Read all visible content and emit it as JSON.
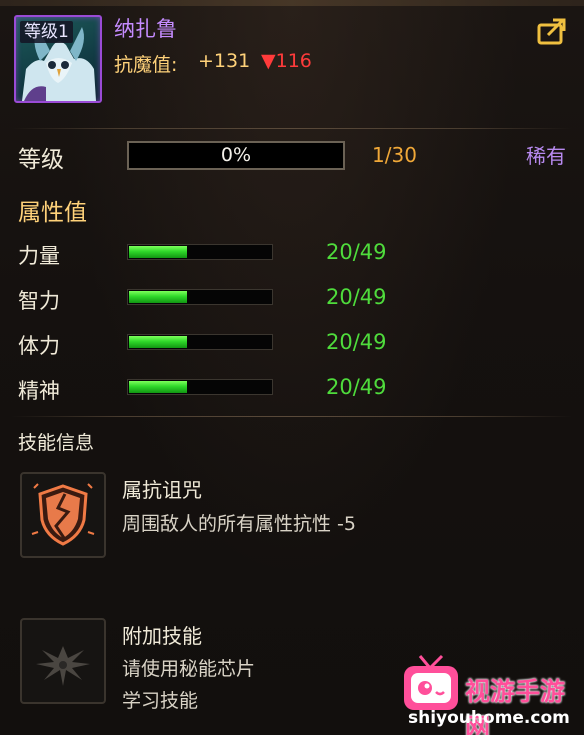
{
  "header": {
    "level_badge": "等级1",
    "unit_name": "纳扎鲁",
    "resist_label": "抗魔值:",
    "resist_bonus": "+131",
    "resist_penalty": "▼116",
    "share_icon": "export-icon"
  },
  "level_row": {
    "label": "等级",
    "xp_percent_text": "0%",
    "xp_fraction": 0.0,
    "count": "1/30",
    "rarity": "稀有"
  },
  "attributes": {
    "title": "属性值",
    "stats": [
      {
        "label": "力量",
        "value": "20/49",
        "fill_fraction": 0.41
      },
      {
        "label": "智力",
        "value": "20/49",
        "fill_fraction": 0.41
      },
      {
        "label": "体力",
        "value": "20/49",
        "fill_fraction": 0.41
      },
      {
        "label": "精神",
        "value": "20/49",
        "fill_fraction": 0.41
      }
    ]
  },
  "skills": {
    "title": "技能信息",
    "items": [
      {
        "name": "属抗诅咒",
        "desc_lines": [
          "周围敌人的所有属性抗性 -5"
        ],
        "icon": "cracked-shield-icon"
      },
      {
        "name": "附加技能",
        "desc_lines": [
          "请使用秘能芯片",
          "学习技能"
        ],
        "icon": "wing-emblem-icon"
      }
    ]
  },
  "watermark": {
    "name": "视游手游网",
    "url": "shiyouhome.com",
    "icon": "tv-mascot-icon"
  },
  "colors": {
    "name_purple": "#c58cff",
    "gold": "#ffd27a",
    "down_red": "#ff3b3b",
    "count_orange": "#f0a838",
    "stat_green": "#4fdc3c",
    "rarity_purple": "#b88af0"
  }
}
